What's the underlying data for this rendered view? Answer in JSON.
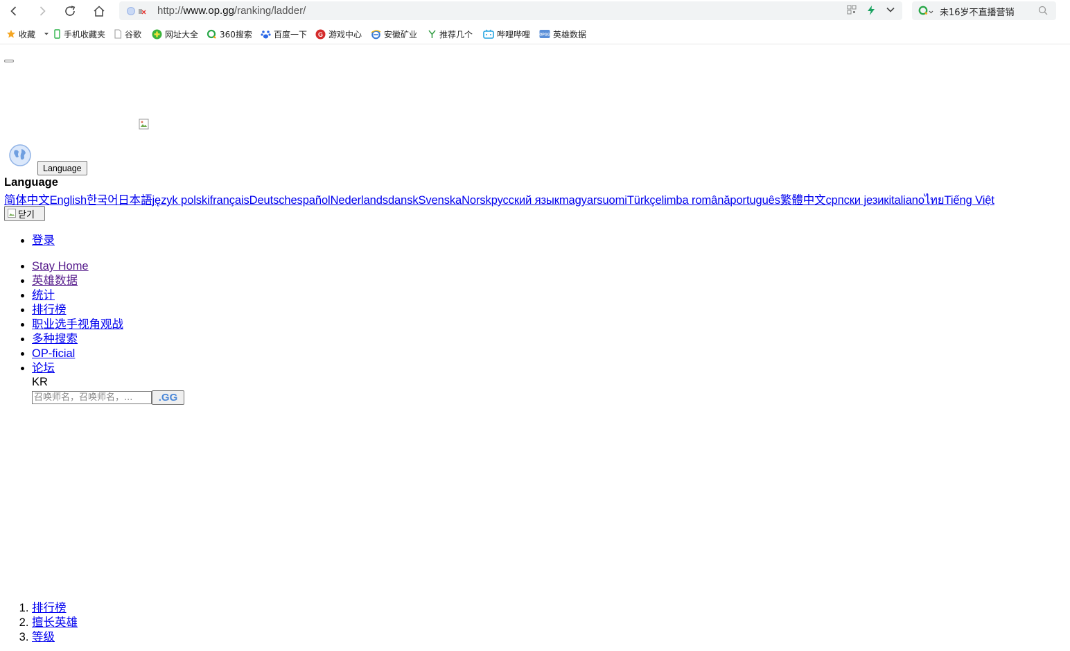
{
  "browser": {
    "url_prefix": "http://",
    "url_host": "www.op.gg",
    "url_path": "/ranking/ladder/",
    "search_hotword": "未16岁不直播营销"
  },
  "bookmarks": [
    {
      "label": "收藏",
      "icon": "star-icon",
      "color": "#f5a623"
    },
    {
      "label": "手机收藏夹",
      "icon": "phone-icon",
      "color": "#2db34a"
    },
    {
      "label": "谷歌",
      "icon": "page-icon",
      "color": "#9e9e9e"
    },
    {
      "label": "网址大全",
      "icon": "plus-circle-icon",
      "color": "#3cb43c"
    },
    {
      "label": "360搜索",
      "icon": "search-360-icon",
      "color": "#f2a20c"
    },
    {
      "label": "百度一下",
      "icon": "paw-icon",
      "color": "#2d68e6"
    },
    {
      "label": "游戏中心",
      "icon": "game-icon",
      "color": "#d42b2b"
    },
    {
      "label": "安徽矿业",
      "icon": "ie-icon",
      "color": "#3a7bd5"
    },
    {
      "label": "推荐几个",
      "icon": "y-icon",
      "color": "#3aa04a"
    },
    {
      "label": "哔哩哔哩",
      "icon": "tv-icon",
      "color": "#23a3e0"
    },
    {
      "label": "英雄数据",
      "icon": "opgg-icon",
      "color": "#5a8fd8"
    }
  ],
  "page": {
    "language_button": "Language",
    "language_heading": "Language",
    "languages": [
      "简体中文",
      "English",
      "한국어",
      "日本語",
      "język polski",
      "français",
      "Deutsch",
      "español",
      "Nederlands",
      "dansk",
      "Svenska",
      "Norsk",
      "русский язык",
      "magyar",
      "suomi",
      "Türkçe",
      "limba română",
      "português",
      "繁體中文",
      "српски језик",
      "italiano",
      "ไทย",
      "Tiếng Việt"
    ],
    "close_label": "닫기",
    "login": "登录",
    "nav": [
      "Stay Home",
      "英雄数据",
      "统计",
      "排行榜",
      "职业选手视角观战",
      "多种搜索",
      "OP-ficial",
      "论坛"
    ],
    "region": "KR",
    "search_placeholder": "召唤师名，召唤师名，...",
    "search_button": ".GG",
    "crumbs": [
      "排行榜",
      "擅长英雄",
      "等级"
    ]
  }
}
